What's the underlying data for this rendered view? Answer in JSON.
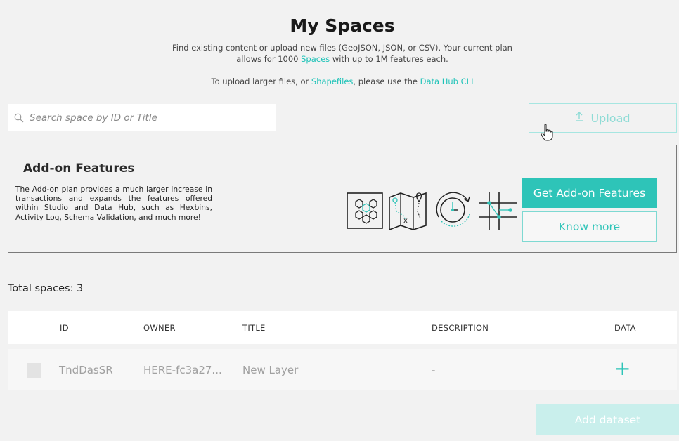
{
  "header": {
    "title": "My Spaces",
    "subtitle_line1_a": "Find existing content or upload new files (GeoJSON, JSON, or CSV). Your current plan",
    "subtitle_line2_a": "allows for 1000 ",
    "subtitle_line2_link": "Spaces",
    "subtitle_line2_b": " with up to 1M features each.",
    "upload_note_a": "To upload larger files, or ",
    "upload_note_link1": "Shapefiles",
    "upload_note_b": ", please use the ",
    "upload_note_link2": "Data Hub CLI"
  },
  "search": {
    "placeholder": "Search space by ID or Title",
    "value": "",
    "icon": "search-icon"
  },
  "upload_button": {
    "label": "Upload",
    "icon": "upload-arrow-icon"
  },
  "addon": {
    "title": "Add-on Features",
    "description": "The Add-on plan provides a much larger increase in transactions and expands the features offered within Studio and Data Hub, such as Hexbins, Activity Log, Schema Validation, and much more!",
    "icons": [
      "hexbin-icon",
      "map-route-icon",
      "activity-clock-icon",
      "grid-schema-icon"
    ],
    "primary_label": "Get Add-on Features",
    "secondary_label": "Know more"
  },
  "spaces": {
    "total_label": "Total spaces: 3",
    "columns": [
      "ID",
      "OWNER",
      "TITLE",
      "DESCRIPTION",
      "DATA"
    ],
    "rows": [
      {
        "id": "TndDasSR",
        "owner": "HERE-fc3a27...",
        "title": "New Layer",
        "description": "-",
        "data_icon": "plus-icon"
      }
    ]
  },
  "add_dataset_label": "Add dataset",
  "colors": {
    "accent": "#2ec4b8",
    "accent_light": "#c9efec",
    "background": "#f2f2f2"
  }
}
